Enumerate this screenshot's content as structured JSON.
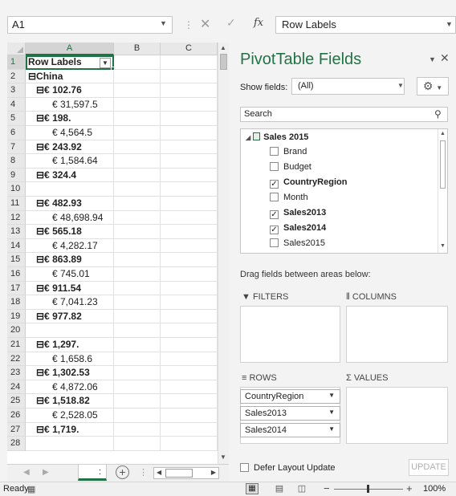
{
  "formula_bar": {
    "name_box": "A1",
    "cancel_icon": "✕",
    "enter_icon": "✓",
    "fx_label": "fx",
    "value": "Row Labels"
  },
  "sheet": {
    "columns": [
      "A",
      "B",
      "C"
    ],
    "rows": [
      {
        "num": "1",
        "text": "Row Labels",
        "bold": true
      },
      {
        "num": "2",
        "text": "⊟China",
        "bold": true
      },
      {
        "num": "3",
        "text": "⊟€ 102.76",
        "bold": true
      },
      {
        "num": "4",
        "text": "€ 31,597.5",
        "bold": false
      },
      {
        "num": "5",
        "text": "⊟€ 198.",
        "bold": true
      },
      {
        "num": "6",
        "text": "€ 4,564.5",
        "bold": false
      },
      {
        "num": "7",
        "text": "⊟€ 243.92",
        "bold": true
      },
      {
        "num": "8",
        "text": "€ 1,584.64",
        "bold": false
      },
      {
        "num": "9",
        "text": "⊟€ 324.4",
        "bold": true
      },
      {
        "num": "10",
        "text": "",
        "bold": false
      },
      {
        "num": "11",
        "text": "⊟€ 482.93",
        "bold": true
      },
      {
        "num": "12",
        "text": "€ 48,698.94",
        "bold": false
      },
      {
        "num": "13",
        "text": "⊟€ 565.18",
        "bold": true
      },
      {
        "num": "14",
        "text": "€ 4,282.17",
        "bold": false
      },
      {
        "num": "15",
        "text": "⊟€ 863.89",
        "bold": true
      },
      {
        "num": "16",
        "text": "€ 745.01",
        "bold": false
      },
      {
        "num": "17",
        "text": "⊟€ 911.54",
        "bold": true
      },
      {
        "num": "18",
        "text": "€ 7,041.23",
        "bold": false
      },
      {
        "num": "19",
        "text": "⊟€ 977.82",
        "bold": true
      },
      {
        "num": "20",
        "text": "",
        "bold": false
      },
      {
        "num": "21",
        "text": "⊟€ 1,297.",
        "bold": true
      },
      {
        "num": "22",
        "text": "€ 1,658.6",
        "bold": false
      },
      {
        "num": "23",
        "text": "⊟€ 1,302.53",
        "bold": true
      },
      {
        "num": "24",
        "text": "€ 4,872.06",
        "bold": false
      },
      {
        "num": "25",
        "text": "⊟€ 1,518.82",
        "bold": true
      },
      {
        "num": "26",
        "text": "€ 2,528.05",
        "bold": false
      },
      {
        "num": "27",
        "text": "⊟€ 1,719.",
        "bold": true
      },
      {
        "num": "28",
        "text": "",
        "bold": false
      }
    ],
    "sheet_tab_label": ":"
  },
  "pivot_pane": {
    "title": "PivotTable Fields",
    "show_fields_label": "Show fields:",
    "show_fields_value": "(All)",
    "search_placeholder": "Search",
    "table_name": "Sales 2015",
    "fields": [
      {
        "name": "Brand",
        "checked": false
      },
      {
        "name": "Budget",
        "checked": false
      },
      {
        "name": "CountryRegion",
        "checked": true
      },
      {
        "name": "Month",
        "checked": false
      },
      {
        "name": "Sales2013",
        "checked": true
      },
      {
        "name": "Sales2014",
        "checked": true
      },
      {
        "name": "Sales2015",
        "checked": false
      }
    ],
    "drag_label": "Drag fields between areas below:",
    "areas": {
      "filters": "FILTERS",
      "columns": "COLUMNS",
      "rows": "ROWS",
      "values": "VALUES"
    },
    "row_fields": [
      "CountryRegion",
      "Sales2013",
      "Sales2014"
    ],
    "defer_label": "Defer Layout Update",
    "update_label": "UPDATE"
  },
  "status_bar": {
    "status": "Ready",
    "zoom": "100%"
  },
  "colors": {
    "excel_green": "#217346"
  }
}
